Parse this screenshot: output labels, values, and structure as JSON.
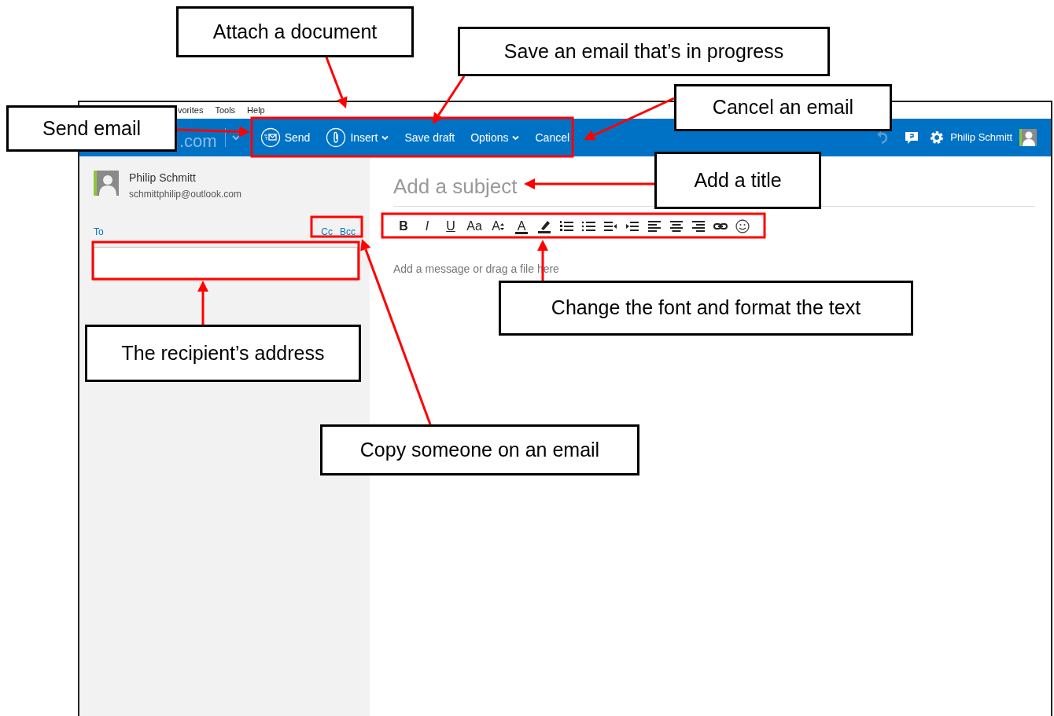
{
  "menu_bar": {
    "items": [
      {
        "label": "vorites"
      },
      {
        "label": "Tools"
      },
      {
        "label": "Help"
      }
    ]
  },
  "header": {
    "logo": ".com",
    "commands": [
      {
        "kind": "send",
        "label": "Send",
        "dropdown": false
      },
      {
        "kind": "insert",
        "label": "Insert",
        "dropdown": true
      },
      {
        "kind": "plain",
        "label": "Save draft",
        "dropdown": false
      },
      {
        "kind": "plain",
        "label": "Options",
        "dropdown": true
      },
      {
        "kind": "plain",
        "label": "Cancel",
        "dropdown": false
      }
    ],
    "user_name": "Philip Schmitt"
  },
  "sender": {
    "name": "Philip Schmitt",
    "email": "schmittphilip@outlook.com"
  },
  "recipients": {
    "to_label": "To",
    "cc_label": "Cc",
    "bcc_label": "Bcc"
  },
  "subject": {
    "placeholder": "Add a subject"
  },
  "format_toolbar": [
    {
      "kind": "bold",
      "label": "B"
    },
    {
      "kind": "italic",
      "label": "I"
    },
    {
      "kind": "underline",
      "label": "U"
    },
    {
      "kind": "font",
      "label": "Aa"
    },
    {
      "kind": "grow",
      "label": "A"
    },
    {
      "kind": "color",
      "label": "A"
    },
    {
      "kind": "highlight"
    },
    {
      "kind": "numbers"
    },
    {
      "kind": "bullets"
    },
    {
      "kind": "outdent"
    },
    {
      "kind": "indent"
    },
    {
      "kind": "left"
    },
    {
      "kind": "center"
    },
    {
      "kind": "right"
    },
    {
      "kind": "link"
    },
    {
      "kind": "emoji"
    }
  ],
  "message": {
    "placeholder": "Add a message or drag a file here"
  },
  "callouts": [
    {
      "text": "Attach a document"
    },
    {
      "text": "Save an email that’s in progress"
    },
    {
      "text": "Cancel an email"
    },
    {
      "text": "Send email"
    },
    {
      "text": "Add a title"
    },
    {
      "text": "Change the font and format the text"
    },
    {
      "text": "The recipient’s address"
    },
    {
      "text": "Copy someone on an email"
    }
  ]
}
